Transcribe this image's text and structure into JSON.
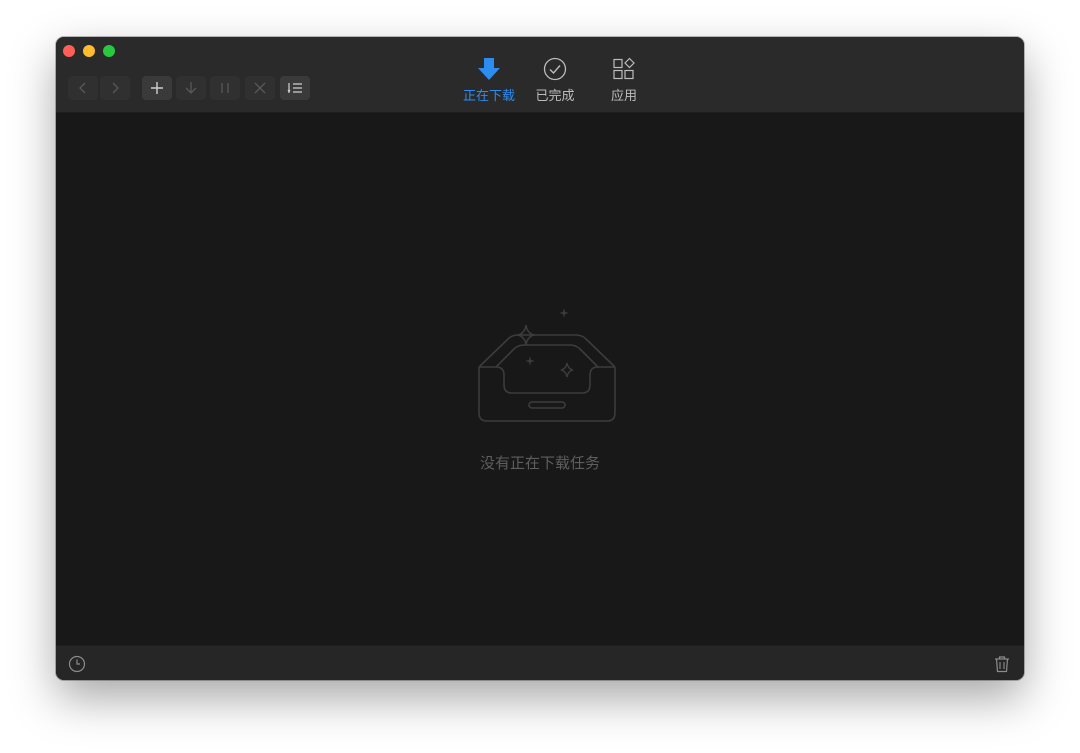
{
  "toolbar": {
    "back": {
      "icon": "chevron-left-icon",
      "enabled": false
    },
    "forward": {
      "icon": "chevron-right-icon",
      "enabled": false
    },
    "add": {
      "icon": "plus-icon",
      "enabled": true
    },
    "start": {
      "icon": "arrow-down-icon",
      "enabled": false
    },
    "pause": {
      "icon": "pause-icon",
      "enabled": false
    },
    "delete": {
      "icon": "close-icon",
      "enabled": false
    },
    "select": {
      "icon": "list-check-icon",
      "enabled": true
    }
  },
  "tabs": [
    {
      "id": "downloading",
      "label": "正在下载",
      "icon": "download-arrow-icon",
      "active": true
    },
    {
      "id": "completed",
      "label": "已完成",
      "icon": "check-circle-icon",
      "active": false
    },
    {
      "id": "apps",
      "label": "应用",
      "icon": "apps-grid-icon",
      "active": false
    }
  ],
  "empty_state": {
    "icon": "empty-inbox-icon",
    "message": "没有正在下载任务"
  },
  "statusbar": {
    "left_icon": "clock-icon",
    "right_icon": "trash-icon"
  },
  "colors": {
    "accent": "#2d8cf0",
    "window_bg": "#181818",
    "toolbar_bg": "#2a2a2a",
    "statusbar_bg": "#262626",
    "empty_text": "#5e5e5e"
  }
}
